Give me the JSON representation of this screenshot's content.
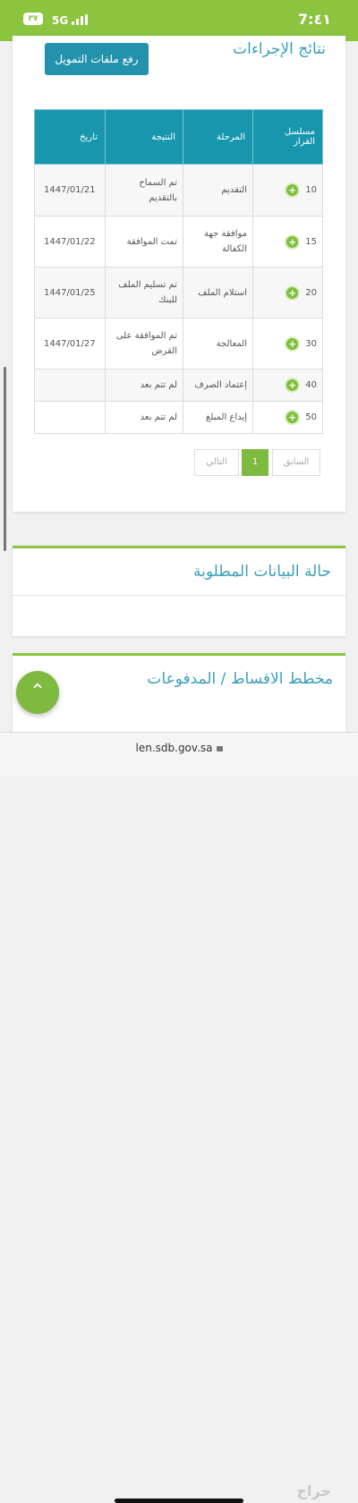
{
  "status": {
    "time": "7:٤١",
    "network": "5G",
    "battery": "٣٧"
  },
  "header": {
    "title": "نتائج الإجراءات",
    "upload_button": "رفع ملفات التمويل"
  },
  "table": {
    "columns": {
      "seq": "مسلسل القرار",
      "stage": "المرحلة",
      "result": "النتيجة",
      "date": "تاريخ"
    },
    "rows": [
      {
        "seq": "10",
        "stage": "التقديم",
        "result": "تم السماح بالتقديم",
        "date": "1447/01/21"
      },
      {
        "seq": "15",
        "stage": "موافقة جهة الكفالة",
        "result": "تمت الموافقة",
        "date": "1447/01/22"
      },
      {
        "seq": "20",
        "stage": "استلام الملف",
        "result": "تم تسليم الملف للبنك",
        "date": "1447/01/25"
      },
      {
        "seq": "30",
        "stage": "المعالجة",
        "result": "تم الموافقة على القرض",
        "date": "1447/01/27"
      },
      {
        "seq": "40",
        "stage": "إعتماد الصرف",
        "result": "لم تتم بعد",
        "date": ""
      },
      {
        "seq": "50",
        "stage": "إيداع المبلغ",
        "result": "لم تتم بعد",
        "date": ""
      }
    ]
  },
  "pagination": {
    "prev": "السابق",
    "page": "1",
    "next": "التالي"
  },
  "sections": {
    "required_data": "حالة البيانات المطلوبة",
    "installments": "مخطط الاقساط / المدفوعات"
  },
  "browser": {
    "url": "len.sdb.gov.sa"
  },
  "watermark": "حراج",
  "colors": {
    "accent_green": "#8bc43f",
    "header_blue": "#1796ae",
    "title_blue": "#3a9fb7"
  }
}
